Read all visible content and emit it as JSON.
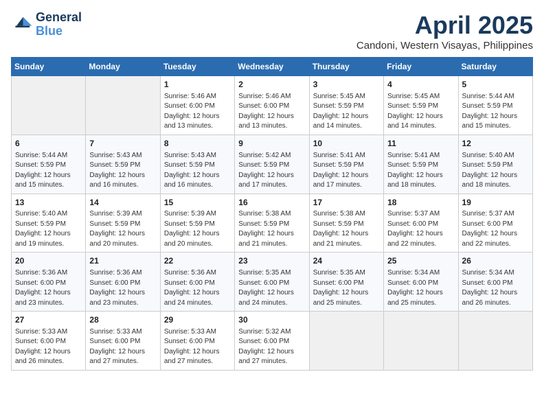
{
  "logo": {
    "line1": "General",
    "line2": "Blue"
  },
  "title": "April 2025",
  "location": "Candoni, Western Visayas, Philippines",
  "days_of_week": [
    "Sunday",
    "Monday",
    "Tuesday",
    "Wednesday",
    "Thursday",
    "Friday",
    "Saturday"
  ],
  "weeks": [
    [
      {
        "day": "",
        "sunrise": "",
        "sunset": "",
        "daylight": ""
      },
      {
        "day": "",
        "sunrise": "",
        "sunset": "",
        "daylight": ""
      },
      {
        "day": "1",
        "sunrise": "Sunrise: 5:46 AM",
        "sunset": "Sunset: 6:00 PM",
        "daylight": "Daylight: 12 hours and 13 minutes."
      },
      {
        "day": "2",
        "sunrise": "Sunrise: 5:46 AM",
        "sunset": "Sunset: 6:00 PM",
        "daylight": "Daylight: 12 hours and 13 minutes."
      },
      {
        "day": "3",
        "sunrise": "Sunrise: 5:45 AM",
        "sunset": "Sunset: 5:59 PM",
        "daylight": "Daylight: 12 hours and 14 minutes."
      },
      {
        "day": "4",
        "sunrise": "Sunrise: 5:45 AM",
        "sunset": "Sunset: 5:59 PM",
        "daylight": "Daylight: 12 hours and 14 minutes."
      },
      {
        "day": "5",
        "sunrise": "Sunrise: 5:44 AM",
        "sunset": "Sunset: 5:59 PM",
        "daylight": "Daylight: 12 hours and 15 minutes."
      }
    ],
    [
      {
        "day": "6",
        "sunrise": "Sunrise: 5:44 AM",
        "sunset": "Sunset: 5:59 PM",
        "daylight": "Daylight: 12 hours and 15 minutes."
      },
      {
        "day": "7",
        "sunrise": "Sunrise: 5:43 AM",
        "sunset": "Sunset: 5:59 PM",
        "daylight": "Daylight: 12 hours and 16 minutes."
      },
      {
        "day": "8",
        "sunrise": "Sunrise: 5:43 AM",
        "sunset": "Sunset: 5:59 PM",
        "daylight": "Daylight: 12 hours and 16 minutes."
      },
      {
        "day": "9",
        "sunrise": "Sunrise: 5:42 AM",
        "sunset": "Sunset: 5:59 PM",
        "daylight": "Daylight: 12 hours and 17 minutes."
      },
      {
        "day": "10",
        "sunrise": "Sunrise: 5:41 AM",
        "sunset": "Sunset: 5:59 PM",
        "daylight": "Daylight: 12 hours and 17 minutes."
      },
      {
        "day": "11",
        "sunrise": "Sunrise: 5:41 AM",
        "sunset": "Sunset: 5:59 PM",
        "daylight": "Daylight: 12 hours and 18 minutes."
      },
      {
        "day": "12",
        "sunrise": "Sunrise: 5:40 AM",
        "sunset": "Sunset: 5:59 PM",
        "daylight": "Daylight: 12 hours and 18 minutes."
      }
    ],
    [
      {
        "day": "13",
        "sunrise": "Sunrise: 5:40 AM",
        "sunset": "Sunset: 5:59 PM",
        "daylight": "Daylight: 12 hours and 19 minutes."
      },
      {
        "day": "14",
        "sunrise": "Sunrise: 5:39 AM",
        "sunset": "Sunset: 5:59 PM",
        "daylight": "Daylight: 12 hours and 20 minutes."
      },
      {
        "day": "15",
        "sunrise": "Sunrise: 5:39 AM",
        "sunset": "Sunset: 5:59 PM",
        "daylight": "Daylight: 12 hours and 20 minutes."
      },
      {
        "day": "16",
        "sunrise": "Sunrise: 5:38 AM",
        "sunset": "Sunset: 5:59 PM",
        "daylight": "Daylight: 12 hours and 21 minutes."
      },
      {
        "day": "17",
        "sunrise": "Sunrise: 5:38 AM",
        "sunset": "Sunset: 5:59 PM",
        "daylight": "Daylight: 12 hours and 21 minutes."
      },
      {
        "day": "18",
        "sunrise": "Sunrise: 5:37 AM",
        "sunset": "Sunset: 6:00 PM",
        "daylight": "Daylight: 12 hours and 22 minutes."
      },
      {
        "day": "19",
        "sunrise": "Sunrise: 5:37 AM",
        "sunset": "Sunset: 6:00 PM",
        "daylight": "Daylight: 12 hours and 22 minutes."
      }
    ],
    [
      {
        "day": "20",
        "sunrise": "Sunrise: 5:36 AM",
        "sunset": "Sunset: 6:00 PM",
        "daylight": "Daylight: 12 hours and 23 minutes."
      },
      {
        "day": "21",
        "sunrise": "Sunrise: 5:36 AM",
        "sunset": "Sunset: 6:00 PM",
        "daylight": "Daylight: 12 hours and 23 minutes."
      },
      {
        "day": "22",
        "sunrise": "Sunrise: 5:36 AM",
        "sunset": "Sunset: 6:00 PM",
        "daylight": "Daylight: 12 hours and 24 minutes."
      },
      {
        "day": "23",
        "sunrise": "Sunrise: 5:35 AM",
        "sunset": "Sunset: 6:00 PM",
        "daylight": "Daylight: 12 hours and 24 minutes."
      },
      {
        "day": "24",
        "sunrise": "Sunrise: 5:35 AM",
        "sunset": "Sunset: 6:00 PM",
        "daylight": "Daylight: 12 hours and 25 minutes."
      },
      {
        "day": "25",
        "sunrise": "Sunrise: 5:34 AM",
        "sunset": "Sunset: 6:00 PM",
        "daylight": "Daylight: 12 hours and 25 minutes."
      },
      {
        "day": "26",
        "sunrise": "Sunrise: 5:34 AM",
        "sunset": "Sunset: 6:00 PM",
        "daylight": "Daylight: 12 hours and 26 minutes."
      }
    ],
    [
      {
        "day": "27",
        "sunrise": "Sunrise: 5:33 AM",
        "sunset": "Sunset: 6:00 PM",
        "daylight": "Daylight: 12 hours and 26 minutes."
      },
      {
        "day": "28",
        "sunrise": "Sunrise: 5:33 AM",
        "sunset": "Sunset: 6:00 PM",
        "daylight": "Daylight: 12 hours and 27 minutes."
      },
      {
        "day": "29",
        "sunrise": "Sunrise: 5:33 AM",
        "sunset": "Sunset: 6:00 PM",
        "daylight": "Daylight: 12 hours and 27 minutes."
      },
      {
        "day": "30",
        "sunrise": "Sunrise: 5:32 AM",
        "sunset": "Sunset: 6:00 PM",
        "daylight": "Daylight: 12 hours and 27 minutes."
      },
      {
        "day": "",
        "sunrise": "",
        "sunset": "",
        "daylight": ""
      },
      {
        "day": "",
        "sunrise": "",
        "sunset": "",
        "daylight": ""
      },
      {
        "day": "",
        "sunrise": "",
        "sunset": "",
        "daylight": ""
      }
    ]
  ]
}
